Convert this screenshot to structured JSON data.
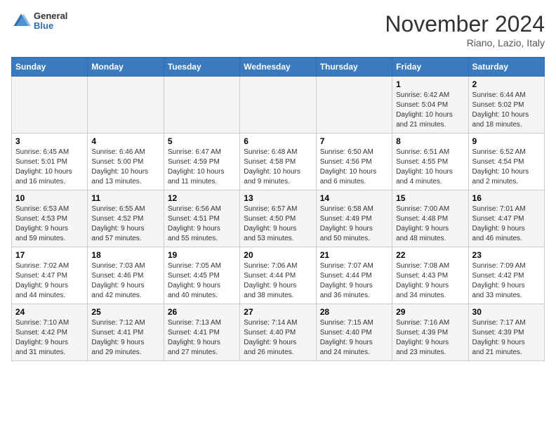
{
  "header": {
    "logo_general": "General",
    "logo_blue": "Blue",
    "month_title": "November 2024",
    "location": "Riano, Lazio, Italy"
  },
  "days_of_week": [
    "Sunday",
    "Monday",
    "Tuesday",
    "Wednesday",
    "Thursday",
    "Friday",
    "Saturday"
  ],
  "weeks": [
    [
      {
        "day": "",
        "info": ""
      },
      {
        "day": "",
        "info": ""
      },
      {
        "day": "",
        "info": ""
      },
      {
        "day": "",
        "info": ""
      },
      {
        "day": "",
        "info": ""
      },
      {
        "day": "1",
        "info": "Sunrise: 6:42 AM\nSunset: 5:04 PM\nDaylight: 10 hours\nand 21 minutes."
      },
      {
        "day": "2",
        "info": "Sunrise: 6:44 AM\nSunset: 5:02 PM\nDaylight: 10 hours\nand 18 minutes."
      }
    ],
    [
      {
        "day": "3",
        "info": "Sunrise: 6:45 AM\nSunset: 5:01 PM\nDaylight: 10 hours\nand 16 minutes."
      },
      {
        "day": "4",
        "info": "Sunrise: 6:46 AM\nSunset: 5:00 PM\nDaylight: 10 hours\nand 13 minutes."
      },
      {
        "day": "5",
        "info": "Sunrise: 6:47 AM\nSunset: 4:59 PM\nDaylight: 10 hours\nand 11 minutes."
      },
      {
        "day": "6",
        "info": "Sunrise: 6:48 AM\nSunset: 4:58 PM\nDaylight: 10 hours\nand 9 minutes."
      },
      {
        "day": "7",
        "info": "Sunrise: 6:50 AM\nSunset: 4:56 PM\nDaylight: 10 hours\nand 6 minutes."
      },
      {
        "day": "8",
        "info": "Sunrise: 6:51 AM\nSunset: 4:55 PM\nDaylight: 10 hours\nand 4 minutes."
      },
      {
        "day": "9",
        "info": "Sunrise: 6:52 AM\nSunset: 4:54 PM\nDaylight: 10 hours\nand 2 minutes."
      }
    ],
    [
      {
        "day": "10",
        "info": "Sunrise: 6:53 AM\nSunset: 4:53 PM\nDaylight: 9 hours\nand 59 minutes."
      },
      {
        "day": "11",
        "info": "Sunrise: 6:55 AM\nSunset: 4:52 PM\nDaylight: 9 hours\nand 57 minutes."
      },
      {
        "day": "12",
        "info": "Sunrise: 6:56 AM\nSunset: 4:51 PM\nDaylight: 9 hours\nand 55 minutes."
      },
      {
        "day": "13",
        "info": "Sunrise: 6:57 AM\nSunset: 4:50 PM\nDaylight: 9 hours\nand 53 minutes."
      },
      {
        "day": "14",
        "info": "Sunrise: 6:58 AM\nSunset: 4:49 PM\nDaylight: 9 hours\nand 50 minutes."
      },
      {
        "day": "15",
        "info": "Sunrise: 7:00 AM\nSunset: 4:48 PM\nDaylight: 9 hours\nand 48 minutes."
      },
      {
        "day": "16",
        "info": "Sunrise: 7:01 AM\nSunset: 4:47 PM\nDaylight: 9 hours\nand 46 minutes."
      }
    ],
    [
      {
        "day": "17",
        "info": "Sunrise: 7:02 AM\nSunset: 4:47 PM\nDaylight: 9 hours\nand 44 minutes."
      },
      {
        "day": "18",
        "info": "Sunrise: 7:03 AM\nSunset: 4:46 PM\nDaylight: 9 hours\nand 42 minutes."
      },
      {
        "day": "19",
        "info": "Sunrise: 7:05 AM\nSunset: 4:45 PM\nDaylight: 9 hours\nand 40 minutes."
      },
      {
        "day": "20",
        "info": "Sunrise: 7:06 AM\nSunset: 4:44 PM\nDaylight: 9 hours\nand 38 minutes."
      },
      {
        "day": "21",
        "info": "Sunrise: 7:07 AM\nSunset: 4:44 PM\nDaylight: 9 hours\nand 36 minutes."
      },
      {
        "day": "22",
        "info": "Sunrise: 7:08 AM\nSunset: 4:43 PM\nDaylight: 9 hours\nand 34 minutes."
      },
      {
        "day": "23",
        "info": "Sunrise: 7:09 AM\nSunset: 4:42 PM\nDaylight: 9 hours\nand 33 minutes."
      }
    ],
    [
      {
        "day": "24",
        "info": "Sunrise: 7:10 AM\nSunset: 4:42 PM\nDaylight: 9 hours\nand 31 minutes."
      },
      {
        "day": "25",
        "info": "Sunrise: 7:12 AM\nSunset: 4:41 PM\nDaylight: 9 hours\nand 29 minutes."
      },
      {
        "day": "26",
        "info": "Sunrise: 7:13 AM\nSunset: 4:41 PM\nDaylight: 9 hours\nand 27 minutes."
      },
      {
        "day": "27",
        "info": "Sunrise: 7:14 AM\nSunset: 4:40 PM\nDaylight: 9 hours\nand 26 minutes."
      },
      {
        "day": "28",
        "info": "Sunrise: 7:15 AM\nSunset: 4:40 PM\nDaylight: 9 hours\nand 24 minutes."
      },
      {
        "day": "29",
        "info": "Sunrise: 7:16 AM\nSunset: 4:39 PM\nDaylight: 9 hours\nand 23 minutes."
      },
      {
        "day": "30",
        "info": "Sunrise: 7:17 AM\nSunset: 4:39 PM\nDaylight: 9 hours\nand 21 minutes."
      }
    ]
  ]
}
